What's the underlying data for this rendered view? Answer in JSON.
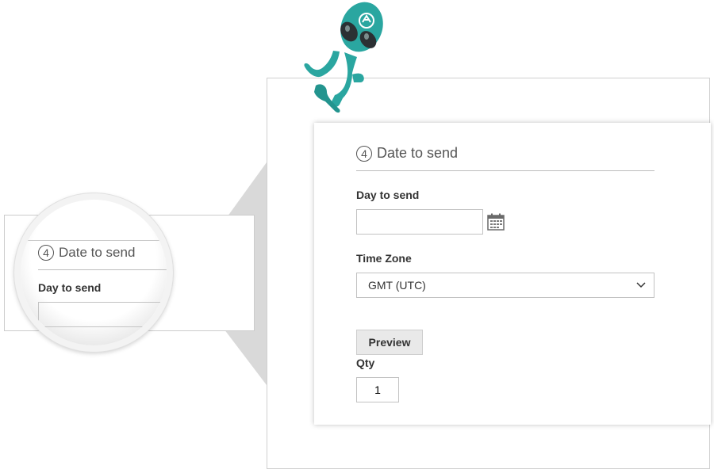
{
  "section": {
    "number": "4",
    "title": "Date to send"
  },
  "fields": {
    "day_to_send_label": "Day to send",
    "day_to_send_value": "",
    "time_zone_label": "Time Zone",
    "time_zone_value": "GMT (UTC)",
    "preview_label": "Preview",
    "qty_label": "Qty",
    "qty_value": "1"
  },
  "icons": {
    "calendar": "calendar-icon",
    "dropdown": "chevron-down-icon",
    "mascot": "alien-mascot-icon"
  },
  "colors": {
    "mascot": "#2aa6a0",
    "button_bg": "#e9e9e9",
    "border": "#c2c2c2"
  }
}
